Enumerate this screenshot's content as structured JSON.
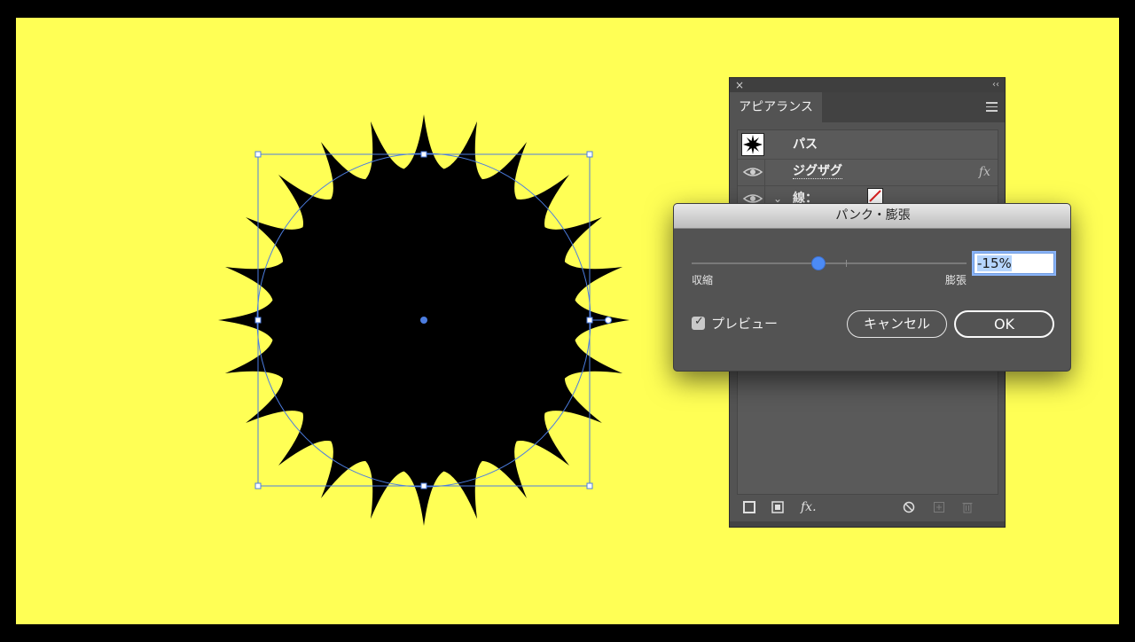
{
  "canvas": {
    "background_color": "#000000",
    "artboard_color": "#ffff55",
    "selection_color": "#4c7de0",
    "shape_fill": "#000000"
  },
  "appearance_panel": {
    "close_glyph": "×",
    "collapse_glyph": "‹‹",
    "tab_label": "アピアランス",
    "menu_icon": "hamburger-icon",
    "rows": {
      "path_label": "パス",
      "effect_label": "ジグザグ",
      "effect_fx": "fx",
      "stroke_label": "線："
    },
    "bottom_icons": [
      "new-stroke-icon",
      "new-fill-icon",
      "fx-menu-icon",
      "clear-appearance-icon",
      "duplicate-item-icon",
      "delete-item-icon"
    ],
    "bottom_fx": "fx."
  },
  "dialog": {
    "title": "パンク・膨張",
    "slider": {
      "min_label": "収縮",
      "max_label": "膨張",
      "min": -200,
      "max": 200,
      "value": -15
    },
    "value_text": "-15%",
    "preview_label": "プレビュー",
    "preview_checked": true,
    "cancel_label": "キャンセル",
    "ok_label": "OK"
  }
}
